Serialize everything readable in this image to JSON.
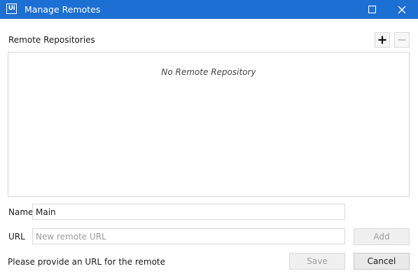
{
  "window": {
    "title": "Manage Remotes",
    "app_icon_text": "Ui",
    "accent_color": "#1c6fd3",
    "controls": [
      "maximize-icon",
      "close-icon"
    ]
  },
  "remotes": {
    "section_label": "Remote Repositories",
    "add_icon": "plus-icon",
    "remove_icon": "minus-icon",
    "empty_text": "No Remote Repository"
  },
  "form": {
    "name_label": "Name",
    "name_value": "Main",
    "url_label": "URL",
    "url_value": "",
    "url_placeholder": "New remote URL",
    "add_label": "Add"
  },
  "footer": {
    "status_text": "Please provide an URL for the remote",
    "save_label": "Save",
    "cancel_label": "Cancel"
  }
}
